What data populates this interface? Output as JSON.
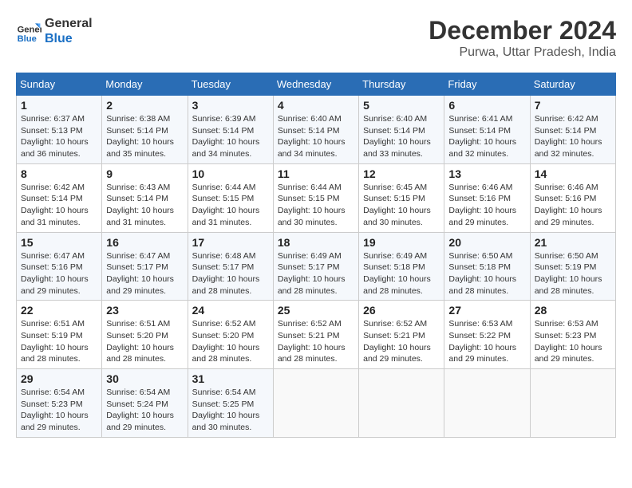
{
  "logo": {
    "line1": "General",
    "line2": "Blue"
  },
  "title": "December 2024",
  "subtitle": "Purwa, Uttar Pradesh, India",
  "days_header": [
    "Sunday",
    "Monday",
    "Tuesday",
    "Wednesday",
    "Thursday",
    "Friday",
    "Saturday"
  ],
  "weeks": [
    [
      {
        "day": "1",
        "sunrise": "6:37 AM",
        "sunset": "5:13 PM",
        "daylight": "10 hours and 36 minutes."
      },
      {
        "day": "2",
        "sunrise": "6:38 AM",
        "sunset": "5:14 PM",
        "daylight": "10 hours and 35 minutes."
      },
      {
        "day": "3",
        "sunrise": "6:39 AM",
        "sunset": "5:14 PM",
        "daylight": "10 hours and 34 minutes."
      },
      {
        "day": "4",
        "sunrise": "6:40 AM",
        "sunset": "5:14 PM",
        "daylight": "10 hours and 34 minutes."
      },
      {
        "day": "5",
        "sunrise": "6:40 AM",
        "sunset": "5:14 PM",
        "daylight": "10 hours and 33 minutes."
      },
      {
        "day": "6",
        "sunrise": "6:41 AM",
        "sunset": "5:14 PM",
        "daylight": "10 hours and 32 minutes."
      },
      {
        "day": "7",
        "sunrise": "6:42 AM",
        "sunset": "5:14 PM",
        "daylight": "10 hours and 32 minutes."
      }
    ],
    [
      {
        "day": "8",
        "sunrise": "6:42 AM",
        "sunset": "5:14 PM",
        "daylight": "10 hours and 31 minutes."
      },
      {
        "day": "9",
        "sunrise": "6:43 AM",
        "sunset": "5:14 PM",
        "daylight": "10 hours and 31 minutes."
      },
      {
        "day": "10",
        "sunrise": "6:44 AM",
        "sunset": "5:15 PM",
        "daylight": "10 hours and 31 minutes."
      },
      {
        "day": "11",
        "sunrise": "6:44 AM",
        "sunset": "5:15 PM",
        "daylight": "10 hours and 30 minutes."
      },
      {
        "day": "12",
        "sunrise": "6:45 AM",
        "sunset": "5:15 PM",
        "daylight": "10 hours and 30 minutes."
      },
      {
        "day": "13",
        "sunrise": "6:46 AM",
        "sunset": "5:16 PM",
        "daylight": "10 hours and 29 minutes."
      },
      {
        "day": "14",
        "sunrise": "6:46 AM",
        "sunset": "5:16 PM",
        "daylight": "10 hours and 29 minutes."
      }
    ],
    [
      {
        "day": "15",
        "sunrise": "6:47 AM",
        "sunset": "5:16 PM",
        "daylight": "10 hours and 29 minutes."
      },
      {
        "day": "16",
        "sunrise": "6:47 AM",
        "sunset": "5:17 PM",
        "daylight": "10 hours and 29 minutes."
      },
      {
        "day": "17",
        "sunrise": "6:48 AM",
        "sunset": "5:17 PM",
        "daylight": "10 hours and 28 minutes."
      },
      {
        "day": "18",
        "sunrise": "6:49 AM",
        "sunset": "5:17 PM",
        "daylight": "10 hours and 28 minutes."
      },
      {
        "day": "19",
        "sunrise": "6:49 AM",
        "sunset": "5:18 PM",
        "daylight": "10 hours and 28 minutes."
      },
      {
        "day": "20",
        "sunrise": "6:50 AM",
        "sunset": "5:18 PM",
        "daylight": "10 hours and 28 minutes."
      },
      {
        "day": "21",
        "sunrise": "6:50 AM",
        "sunset": "5:19 PM",
        "daylight": "10 hours and 28 minutes."
      }
    ],
    [
      {
        "day": "22",
        "sunrise": "6:51 AM",
        "sunset": "5:19 PM",
        "daylight": "10 hours and 28 minutes."
      },
      {
        "day": "23",
        "sunrise": "6:51 AM",
        "sunset": "5:20 PM",
        "daylight": "10 hours and 28 minutes."
      },
      {
        "day": "24",
        "sunrise": "6:52 AM",
        "sunset": "5:20 PM",
        "daylight": "10 hours and 28 minutes."
      },
      {
        "day": "25",
        "sunrise": "6:52 AM",
        "sunset": "5:21 PM",
        "daylight": "10 hours and 28 minutes."
      },
      {
        "day": "26",
        "sunrise": "6:52 AM",
        "sunset": "5:21 PM",
        "daylight": "10 hours and 29 minutes."
      },
      {
        "day": "27",
        "sunrise": "6:53 AM",
        "sunset": "5:22 PM",
        "daylight": "10 hours and 29 minutes."
      },
      {
        "day": "28",
        "sunrise": "6:53 AM",
        "sunset": "5:23 PM",
        "daylight": "10 hours and 29 minutes."
      }
    ],
    [
      {
        "day": "29",
        "sunrise": "6:54 AM",
        "sunset": "5:23 PM",
        "daylight": "10 hours and 29 minutes."
      },
      {
        "day": "30",
        "sunrise": "6:54 AM",
        "sunset": "5:24 PM",
        "daylight": "10 hours and 29 minutes."
      },
      {
        "day": "31",
        "sunrise": "6:54 AM",
        "sunset": "5:25 PM",
        "daylight": "10 hours and 30 minutes."
      },
      null,
      null,
      null,
      null
    ]
  ]
}
